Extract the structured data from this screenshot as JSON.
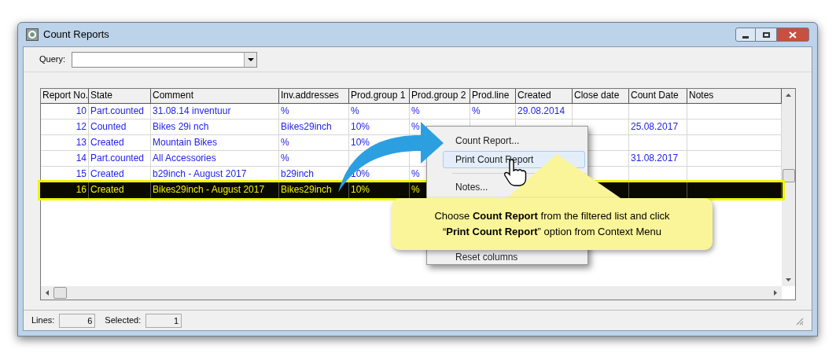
{
  "window": {
    "title": "Count Reports"
  },
  "query": {
    "label": "Query:"
  },
  "table": {
    "columns": [
      "Report No.",
      "State",
      "Comment",
      "Inv.addresses",
      "Prod.group 1",
      "Prod.group 2",
      "Prod.line",
      "Created",
      "Close date",
      "Count Date",
      "Notes"
    ],
    "rows": [
      {
        "selected": false,
        "cells": [
          "10",
          "Part.counted",
          "31.08.14 inventuur",
          "%",
          "%",
          "%",
          "%",
          "29.08.2014",
          null,
          null,
          null
        ]
      },
      {
        "selected": false,
        "cells": [
          "12",
          "Counted",
          "Bikes 29i nch",
          "Bikes29inch",
          "10%",
          "%",
          null,
          null,
          null,
          "25.08.2017",
          null
        ]
      },
      {
        "selected": false,
        "cells": [
          "13",
          "Created",
          "Mountain Bikes",
          "%",
          "10%",
          null,
          null,
          null,
          null,
          null,
          null
        ]
      },
      {
        "selected": false,
        "cells": [
          "14",
          "Part.counted",
          "All Accessories",
          "%",
          null,
          null,
          null,
          null,
          null,
          "31.08.2017",
          null
        ]
      },
      {
        "selected": false,
        "cells": [
          "15",
          "Created",
          "b29inch - August 2017",
          "b29inch",
          "10%",
          "%",
          null,
          null,
          null,
          null,
          null
        ]
      },
      {
        "selected": true,
        "cells": [
          "16",
          "Created",
          "Bikes29inch - August 2017",
          "Bikes29inch",
          "10%",
          "%",
          null,
          null,
          null,
          null,
          null
        ]
      }
    ]
  },
  "context_menu": {
    "items": [
      {
        "label": "Count Report...",
        "selected": false,
        "separator_after": false
      },
      {
        "label": "Print Count Report",
        "selected": true,
        "separator_after": true
      },
      {
        "label": "Notes...",
        "selected": false,
        "separator_after": false
      },
      {
        "label": "Reset columns",
        "selected": false,
        "separator_after": false
      }
    ]
  },
  "callout": {
    "text": "Choose **Count Report** from the filtered list and click “**Print Count Report**” option from Context Menu"
  },
  "status_bar": {
    "lines_label": "Lines:",
    "lines": "6",
    "selected_label": "Selected:",
    "selected": "1"
  }
}
